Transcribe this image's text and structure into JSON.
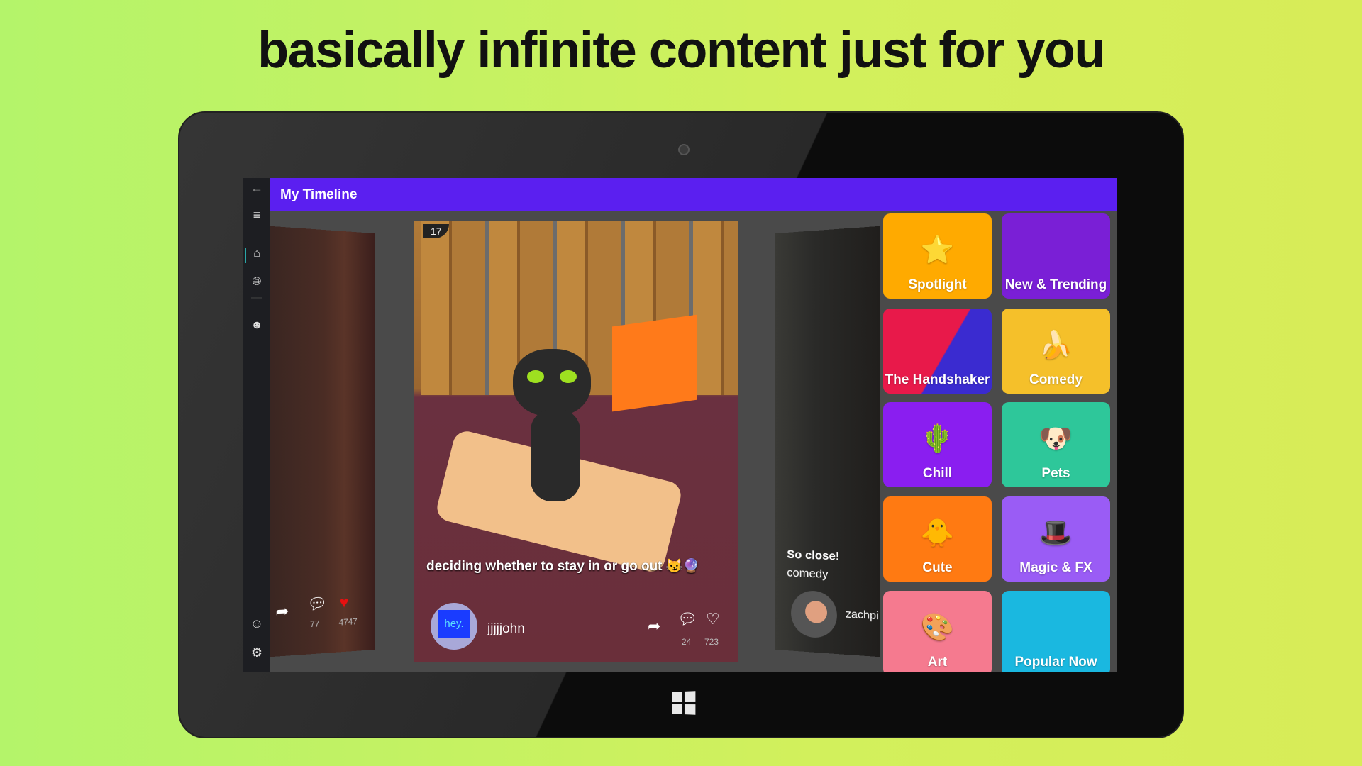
{
  "headline": "basically infinite content just for you",
  "app": {
    "header_title": "My Timeline",
    "sidebar": {
      "icons": [
        "back-arrow-icon",
        "hamburger-menu-icon",
        "home-icon",
        "globe-icon",
        "user-icon",
        "emoji-icon",
        "gear-icon"
      ]
    },
    "feed": {
      "left_card": {
        "comments": "77",
        "likes": "4747"
      },
      "center_card": {
        "caption": "deciding whether to stay in or go out 😼🔮",
        "avatar_text": "hey.",
        "username": "jjjjjohn",
        "dart_number": "17",
        "comments": "24",
        "likes": "723"
      },
      "right_card": {
        "caption": "So close!",
        "tag": "comedy",
        "username": "zachpi"
      }
    },
    "categories": [
      {
        "label": "Spotlight",
        "color": "#ffaa00",
        "icon": "⭐"
      },
      {
        "label": "New & Trending",
        "color": "#7a1fd6",
        "icon": ""
      },
      {
        "label": "The Handshaker",
        "color": "#e8194a",
        "icon": ""
      },
      {
        "label": "Comedy",
        "color": "#f5c02a",
        "icon": "🍌"
      },
      {
        "label": "Chill",
        "color": "#8a1ef0",
        "icon": "🌵"
      },
      {
        "label": "Pets",
        "color": "#2ec79a",
        "icon": "🐶"
      },
      {
        "label": "Cute",
        "color": "#ff7a12",
        "icon": "🐥"
      },
      {
        "label": "Magic & FX",
        "color": "#9a5cf5",
        "icon": "🎩"
      },
      {
        "label": "Art",
        "color": "#f57a8f",
        "icon": "🎨"
      },
      {
        "label": "Popular Now",
        "color": "#1ab8e0",
        "icon": ""
      }
    ]
  },
  "colors": {
    "header": "#5b1ff0",
    "like_red": "#e81010",
    "content_bg": "#4a4a4a"
  }
}
